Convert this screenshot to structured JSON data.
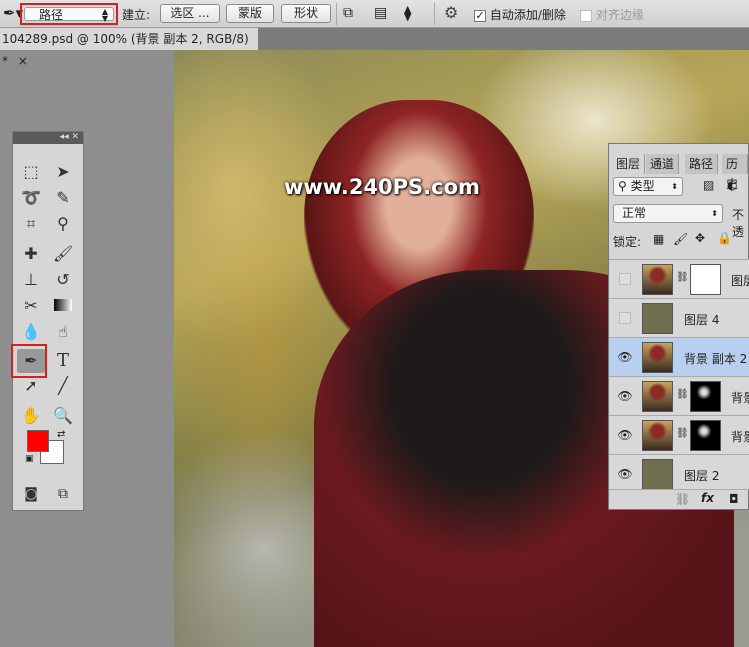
{
  "options_bar": {
    "path_mode": "路径",
    "make_label": "建立:",
    "selection_button": "选区 ...",
    "mask_button": "蒙版",
    "shape_button": "形状",
    "auto_add_delete_label": "自动添加/删除",
    "auto_add_delete_checked": true,
    "align_edges_label": "对齐边缘",
    "align_edges_checked": false
  },
  "document_tab": {
    "title": "104289.psd @ 100% (背景 副本 2, RGB/8) *",
    "close": "×"
  },
  "canvas": {
    "watermark": "www.240PS.com"
  },
  "tools_panel": {
    "header": "◂◂ ✕",
    "active_tool": "pen-tool",
    "foreground_color": "#ff0000",
    "background_color": "#ffffff",
    "type_glyph": "T"
  },
  "layers_panel": {
    "tabs": [
      "图层",
      "通道",
      "路径",
      "历史"
    ],
    "filter_label": "类型",
    "blend_mode": "正常",
    "opacity_label": "不透",
    "lock_label": "锁定:",
    "layers": [
      {
        "name": "图层",
        "visible": false,
        "has_mask": true,
        "mask": "white",
        "thumb": "photo"
      },
      {
        "name": "图层 4",
        "visible": false,
        "has_mask": false,
        "thumb": "olive"
      },
      {
        "name": "背景 副本 2",
        "visible": true,
        "has_mask": false,
        "thumb": "photo",
        "selected": true
      },
      {
        "name": "背景",
        "visible": true,
        "has_mask": true,
        "mask": "black",
        "thumb": "photo"
      },
      {
        "name": "背景",
        "visible": true,
        "has_mask": true,
        "mask": "black",
        "thumb": "photo"
      },
      {
        "name": "图层 2",
        "visible": true,
        "has_mask": false,
        "thumb": "olive"
      }
    ],
    "footer_icons": [
      "link-icon",
      "fx-icon",
      "mask-icon"
    ],
    "fx_label": "fx"
  }
}
